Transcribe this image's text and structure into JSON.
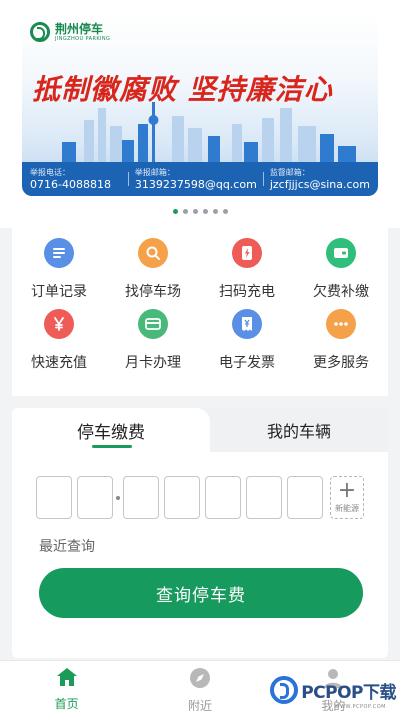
{
  "banner": {
    "logo_cn": "荆州停车",
    "logo_en": "JINGZHOU PARKING",
    "slogan": "抵制徽腐败 坚持廉洁心",
    "report_phone_label": "举报电话：",
    "report_phone": "0716-4088818",
    "report_email_label": "举报邮箱：",
    "report_email": "3139237598@qq.com",
    "supervise_email_label": "监督邮箱：",
    "supervise_email": "jzcfjjjcs@sina.com",
    "dots_count": 6,
    "active_dot": 0
  },
  "menu": {
    "items": [
      {
        "label": "订单记录",
        "icon": "list-icon",
        "color": "#5a8fe6"
      },
      {
        "label": "找停车场",
        "icon": "search-icon",
        "color": "#f5a14a"
      },
      {
        "label": "扫码充电",
        "icon": "charge-icon",
        "color": "#ef5b56"
      },
      {
        "label": "欠费补缴",
        "icon": "wallet-icon",
        "color": "#2fbf7a"
      },
      {
        "label": "快速充值",
        "icon": "yen-icon",
        "color": "#ef5b56"
      },
      {
        "label": "月卡办理",
        "icon": "card-icon",
        "color": "#49b979"
      },
      {
        "label": "电子发票",
        "icon": "invoice-icon",
        "color": "#5a8fe6"
      },
      {
        "label": "更多服务",
        "icon": "more-icon",
        "color": "#f5a14a"
      }
    ]
  },
  "parking": {
    "tab_pay": "停车缴费",
    "tab_vehicles": "我的车辆",
    "new_energy_label": "新能源",
    "recent_query": "最近查询",
    "query_button": "查询停车费"
  },
  "nav": {
    "home": "首页",
    "nearby": "附近",
    "mine": "我的"
  },
  "watermark": {
    "text": "PCPOP下载",
    "sub": "WWW.PCPOP.COM"
  },
  "colors": {
    "primary": "#169a5e",
    "banner_blue": "#1d63b3",
    "slogan_red": "#d9261c"
  }
}
